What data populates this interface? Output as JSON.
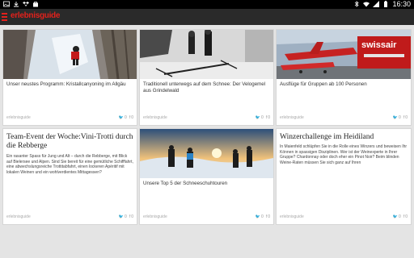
{
  "statusbar": {
    "time": "16:30",
    "icons_left": [
      "image-icon",
      "download-icon",
      "dropbox-icon",
      "bag-icon"
    ],
    "icons_right": [
      "bluetooth-icon",
      "wifi-icon",
      "signal-icon",
      "battery-icon"
    ]
  },
  "appbar": {
    "logo": "erlebnisguide",
    "menu_icon": "hamburger-menu-icon"
  },
  "cards": [
    {
      "title": "Unser neustes Programm: Kristallcanyoning im Allgäu",
      "source": "erlebnisguide",
      "twitter_count": "0",
      "facebook_count": "0",
      "image": "ice-canyoning-photo"
    },
    {
      "title": "Traditionell unterwegs auf dem Schnee: Der Velogemel aus Grindelwald",
      "source": "erlebnisguide",
      "twitter_count": "0",
      "facebook_count": "0",
      "image": "velogemel-snow-photo"
    },
    {
      "title": "Ausflüge für Gruppen ab 100 Personen",
      "source": "erlebnisguide",
      "twitter_count": "0",
      "facebook_count": "0",
      "image": "swissair-aircraft-hall-photo",
      "image_text": "swissair"
    },
    {
      "headline": "Team-Event der Woche:Vini-Trotti durch die Rebberge",
      "description": "Ein rasanter Spass für Jung und Alt – durch die Rebberge, mit Blick auf Bielersee und Alpen. Sind Sie bereit für eine gemütliche Schifffahrt, eine abwechslungsreiche Trottitabfahrt, einen lockeren Apéritif mit lokalen Weinen und ein wohlverdientes Mittagessen?",
      "source": "erlebnisguide",
      "twitter_count": "0",
      "facebook_count": "0"
    },
    {
      "title": "Unsere Top 5 der Schneeschuhtouren",
      "source": "erlebnisguide",
      "twitter_count": "0",
      "facebook_count": "0",
      "image": "snowshoe-hikers-sunset-photo"
    },
    {
      "headline": "Winzerchallenge im Heidiland",
      "description": "In Maienfeld schlüpfen Sie in die Rolle eines Winzers und beweisen Ihr Können in spassigen Disziplinen. Wer ist der Weinexperte in Ihrer Gruppe? Chardonnay oder doch eher ein Pinot Noir? Beim blinden Weine-Raten müssen Sie sich ganz auf Ihren",
      "source": "erlebnisguide",
      "twitter_count": "0",
      "facebook_count": "0"
    }
  ],
  "colors": {
    "accent": "#e2211c",
    "appbar": "#2a2a2a",
    "background": "#e4e4e4"
  }
}
